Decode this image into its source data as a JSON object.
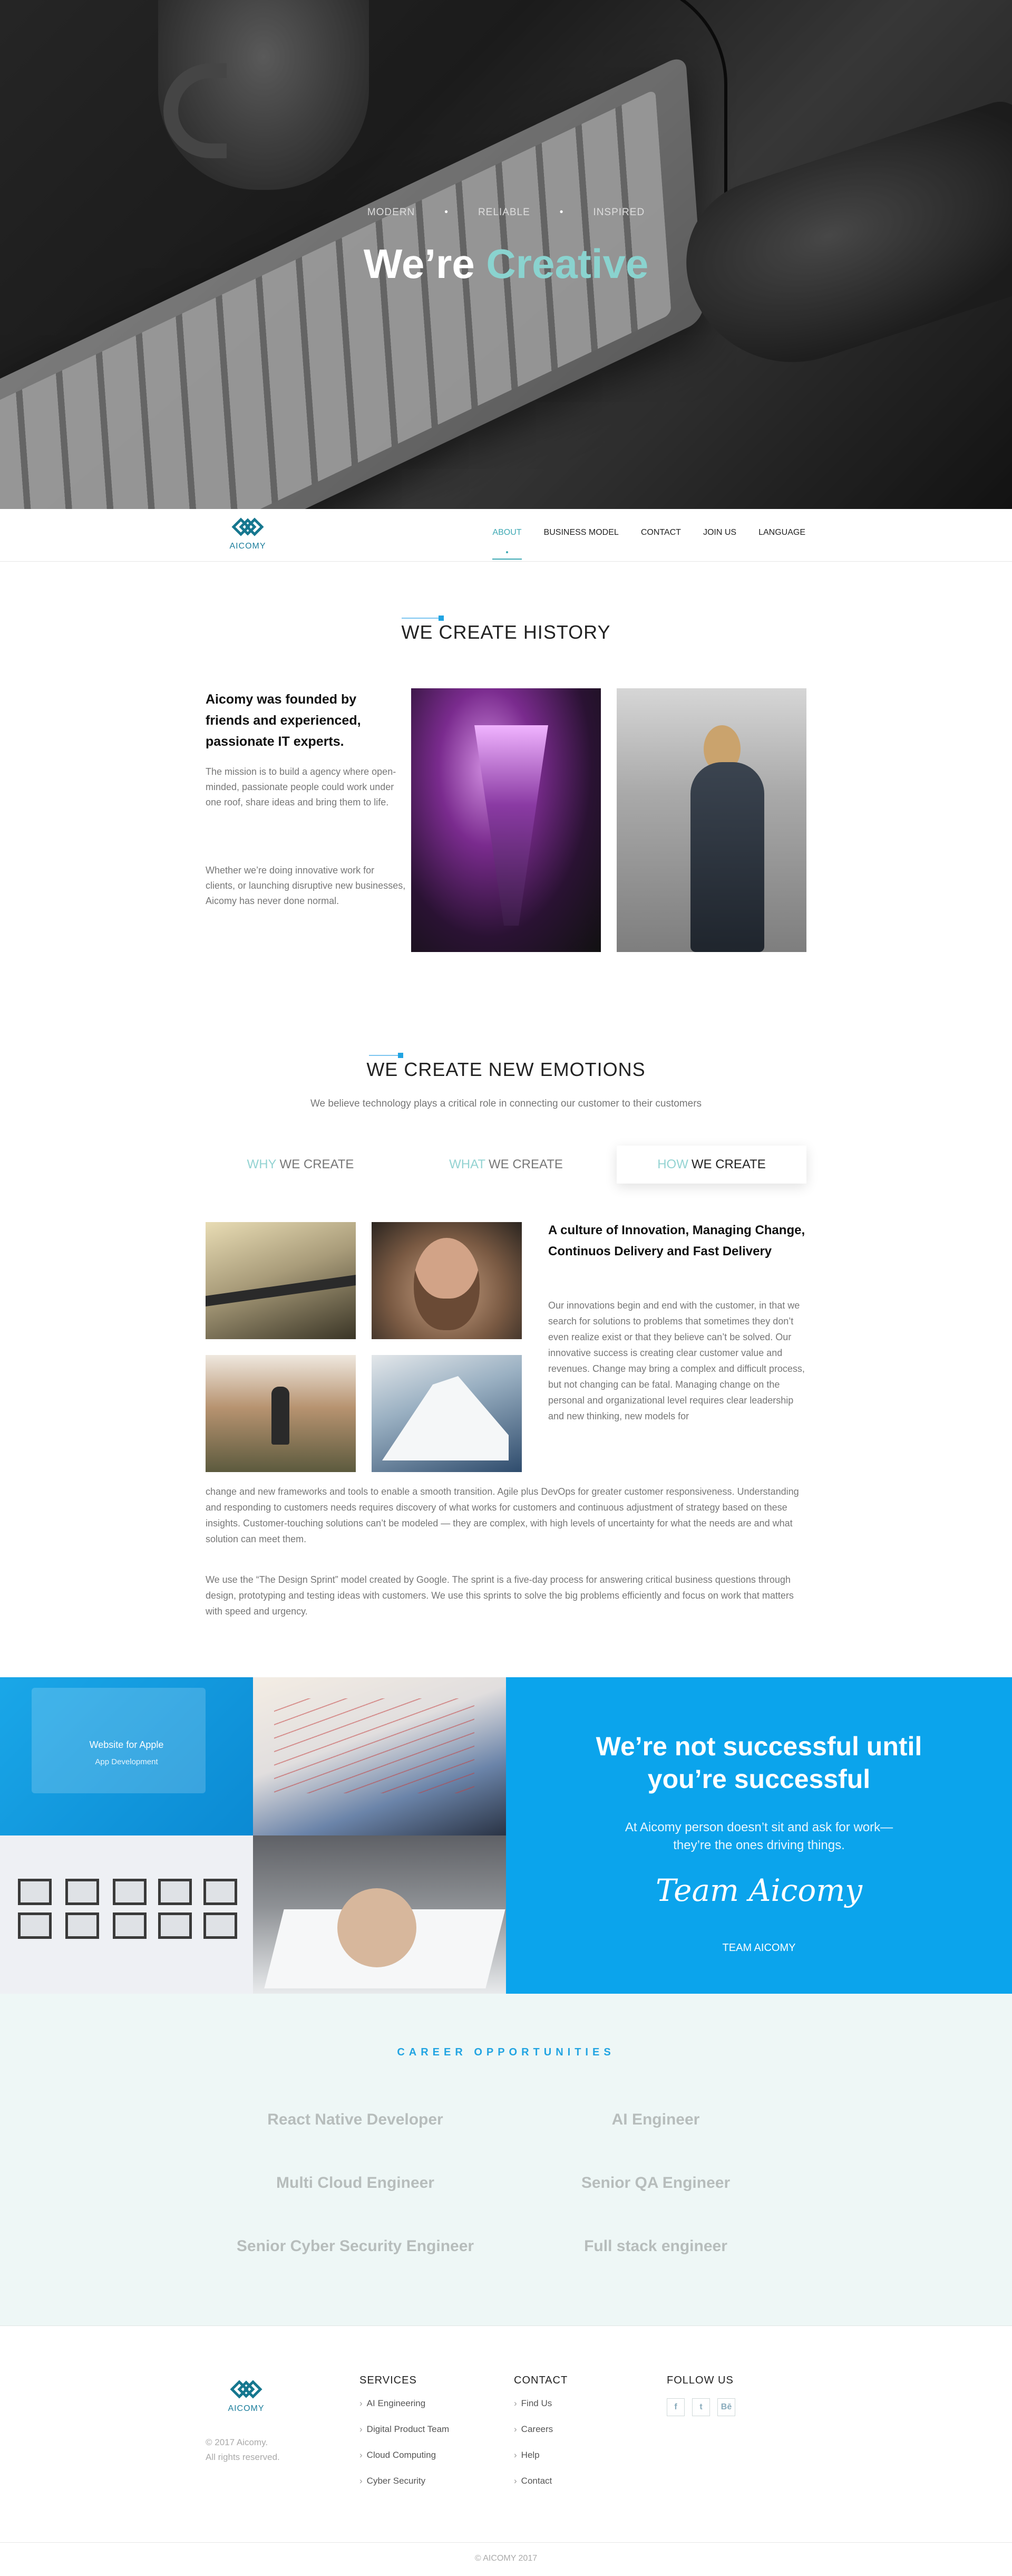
{
  "hero": {
    "tagline": [
      "MODERN",
      "RELIABLE",
      "INSPIRED"
    ],
    "title_main": "We’re",
    "title_accent": "Creative"
  },
  "nav": {
    "logo_text": "AICOMY",
    "items": [
      "ABOUT",
      "BUSINESS MODEL",
      "CONTACT",
      "JOIN US",
      "LANGUAGE"
    ],
    "active": "ABOUT"
  },
  "history": {
    "title": "WE CREATE HISTORY",
    "heading": "Aicomy was founded by friends and experienced, passionate IT experts.",
    "p1": "The mission is to build a agency where open-minded, passionate people could work under one roof, share ideas and bring them to life.",
    "p2": "Whether we’re doing innovative work for clients, or launching disruptive new businesses, Aicomy has never done normal."
  },
  "emotions": {
    "title": "WE CREATE NEW EMOTIONS",
    "subtitle": "We believe technology plays a critical role in connecting our customer to their customers",
    "tabs": [
      {
        "kw": "WHY",
        "rest": "WE CREATE"
      },
      {
        "kw": "WHAT",
        "rest": "WE CREATE"
      },
      {
        "kw": "HOW",
        "rest": "WE CREATE"
      }
    ],
    "active_tab": "HOW WE CREATE",
    "heading": "A culture of Innovation, Managing Change, Continuos Delivery and Fast Delivery",
    "p_side": "Our innovations begin and end with the customer, in that we search for solutions to problems that sometimes they don’t even realize exist or that they believe can’t be solved. Our innovative success is creating clear customer value and revenues. Change may bring a complex and difficult process, but not changing can be fatal. Managing change on the personal and organizational level requires clear leadership and new thinking, new models for",
    "p_full": "change and new frameworks and tools to enable a smooth transition. Agile plus DevOps for greater customer responsiveness. Understanding and responding to customers needs requires discovery of what works for customers and continuous adjustment of strategy based on these insights. Customer-touching solutions can’t be modeled — they are complex, with high levels of uncertainty for what the needs are and what solution can meet them.",
    "p_last": "We use the “The Design Sprint” model created by Google. The sprint is a five-day process for answering critical business questions through design, prototyping and testing ideas with customers. We use this sprints to solve the big problems efficiently and focus on work that matters with speed and urgency."
  },
  "showcase": {
    "tile_title": "Website for Apple",
    "tile_sub": "App Development",
    "big": "We’re not successful until you’re successful",
    "mid": "At Aicomy person doesn’t sit and ask for work—they’re the ones driving things.",
    "signature": "Team Aicomy",
    "team": "TEAM AICOMY"
  },
  "career": {
    "title": "CAREER OPPORTUNITIES",
    "jobs": [
      "React Native Developer",
      "AI Engineer",
      "Multi Cloud Engineer",
      "Senior QA Engineer",
      "Senior Cyber Security Engineer",
      "Full stack engineer"
    ]
  },
  "footer": {
    "logo_text": "AICOMY",
    "copy1": "© 2017 Aicomy.",
    "copy2": "All rights reserved.",
    "services_title": "SERVICES",
    "services": [
      "AI Engineering",
      "Digital Product Team",
      "Cloud Computing",
      "Cyber Security"
    ],
    "contact_title": "CONTACT",
    "contact": [
      "Find Us",
      "Careers",
      "Help",
      "Contact"
    ],
    "follow_title": "FOLLOW US",
    "social": [
      "f",
      "t",
      "Bē"
    ],
    "social_icons": [
      "facebook-icon",
      "twitter-icon",
      "behance-icon"
    ],
    "bottom": "© AICOMY 2017"
  },
  "colors": {
    "accent": "#8ad3cf",
    "blue": "#0ba4ec",
    "career_title": "#21a4e2"
  }
}
